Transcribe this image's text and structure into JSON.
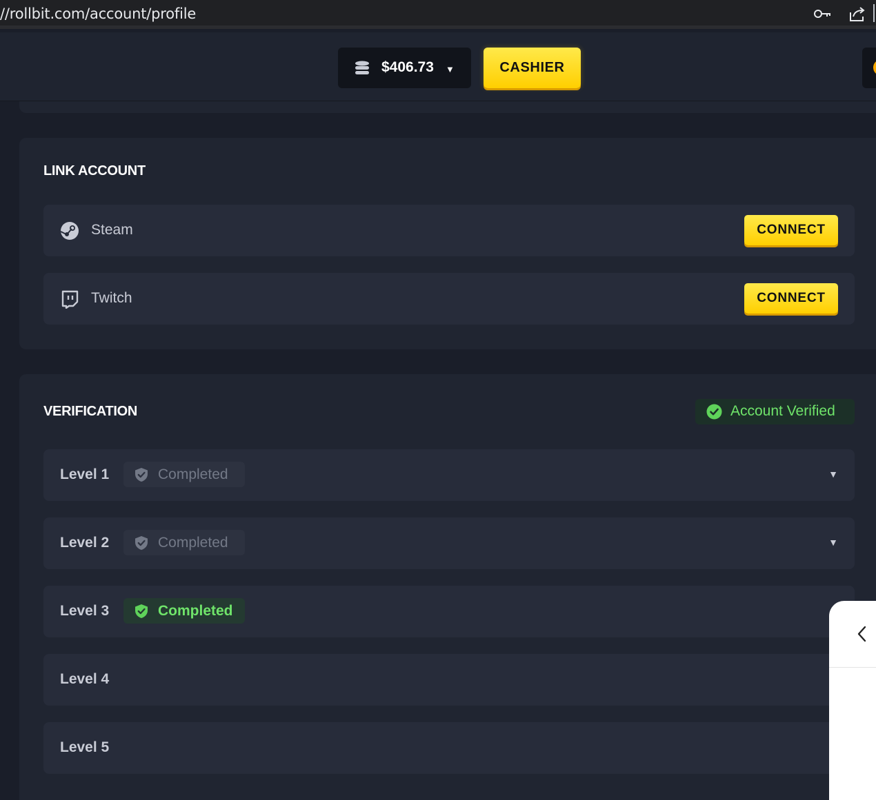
{
  "browser": {
    "url": "//rollbit.com/account/profile",
    "icons": [
      "key-icon",
      "share-icon"
    ]
  },
  "header": {
    "balance": "$406.73",
    "balance_icon": "coins-icon",
    "cashier_label": "CASHIER"
  },
  "link_account": {
    "title": "LINK ACCOUNT",
    "items": [
      {
        "name": "Steam",
        "icon": "steam-icon",
        "button": "CONNECT"
      },
      {
        "name": "Twitch",
        "icon": "twitch-icon",
        "button": "CONNECT"
      }
    ]
  },
  "verification": {
    "title": "VERIFICATION",
    "badge": "Account Verified",
    "levels": [
      {
        "label": "Level 1",
        "status": "Completed",
        "state": "muted",
        "expandable": true
      },
      {
        "label": "Level 2",
        "status": "Completed",
        "state": "muted",
        "expandable": true
      },
      {
        "label": "Level 3",
        "status": "Completed",
        "state": "active",
        "expandable": false
      },
      {
        "label": "Level 4"
      },
      {
        "label": "Level 5"
      }
    ]
  },
  "colors": {
    "accent": "#ffd400",
    "success": "#6fe46a",
    "card_bg": "#202531",
    "row_bg": "#272c3a"
  }
}
